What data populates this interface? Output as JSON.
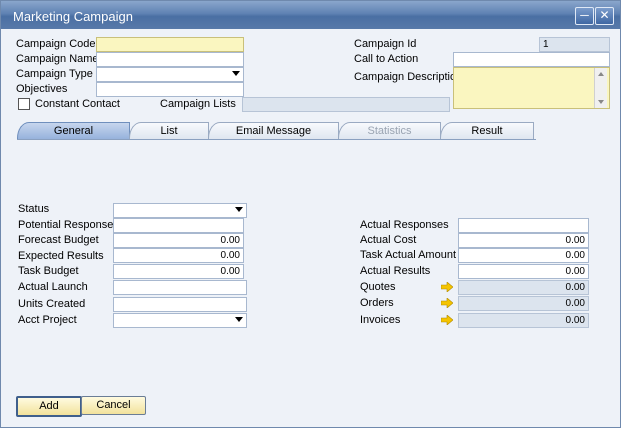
{
  "window": {
    "title": "Marketing Campaign"
  },
  "header": {
    "campaign_code": {
      "label": "Campaign Code",
      "value": ""
    },
    "campaign_name": {
      "label": "Campaign Name",
      "value": ""
    },
    "campaign_type": {
      "label": "Campaign Type",
      "value": ""
    },
    "objectives": {
      "label": "Objectives",
      "value": ""
    },
    "constant_contact": {
      "label": "Constant Contact",
      "checked": false
    },
    "campaign_lists": {
      "label": "Campaign Lists",
      "value": ""
    },
    "campaign_id": {
      "label": "Campaign Id",
      "value": "1"
    },
    "call_to_action": {
      "label": "Call to Action",
      "value": ""
    },
    "campaign_description": {
      "label": "Campaign Description",
      "value": ""
    }
  },
  "tabs": [
    {
      "label": "General",
      "state": "active"
    },
    {
      "label": "List",
      "state": "normal"
    },
    {
      "label": "Email Message",
      "state": "normal"
    },
    {
      "label": "Statistics",
      "state": "disabled"
    },
    {
      "label": "Result",
      "state": "normal"
    }
  ],
  "general": {
    "left": [
      {
        "label": "Status",
        "value": "",
        "kind": "dropdown"
      },
      {
        "label": "Potential Responses",
        "value": ""
      },
      {
        "label": "Forecast Budget",
        "value": "0.00"
      },
      {
        "label": "Expected Results",
        "value": "0.00"
      },
      {
        "label": "Task Budget",
        "value": "0.00"
      },
      {
        "label": "Actual Launch",
        "value": ""
      },
      {
        "label": "Units Created",
        "value": ""
      },
      {
        "label": "Acct Project",
        "value": "",
        "kind": "dropdown"
      }
    ],
    "right": [
      {
        "label": "Actual Responses",
        "value": ""
      },
      {
        "label": "Actual Cost",
        "value": "0.00"
      },
      {
        "label": "Task Actual Amount",
        "value": "0.00"
      },
      {
        "label": "Actual Results",
        "value": "0.00"
      },
      {
        "label": "Quotes",
        "value": "0.00",
        "link": true
      },
      {
        "label": "Orders",
        "value": "0.00",
        "link": true
      },
      {
        "label": "Invoices",
        "value": "0.00",
        "link": true
      }
    ]
  },
  "buttons": {
    "add": "Add",
    "cancel": "Cancel"
  },
  "colors": {
    "accent": "#5f82b3",
    "field_yellow": "#faf6c0",
    "readonly": "#dce4ee",
    "arrow": "#f5c400"
  }
}
